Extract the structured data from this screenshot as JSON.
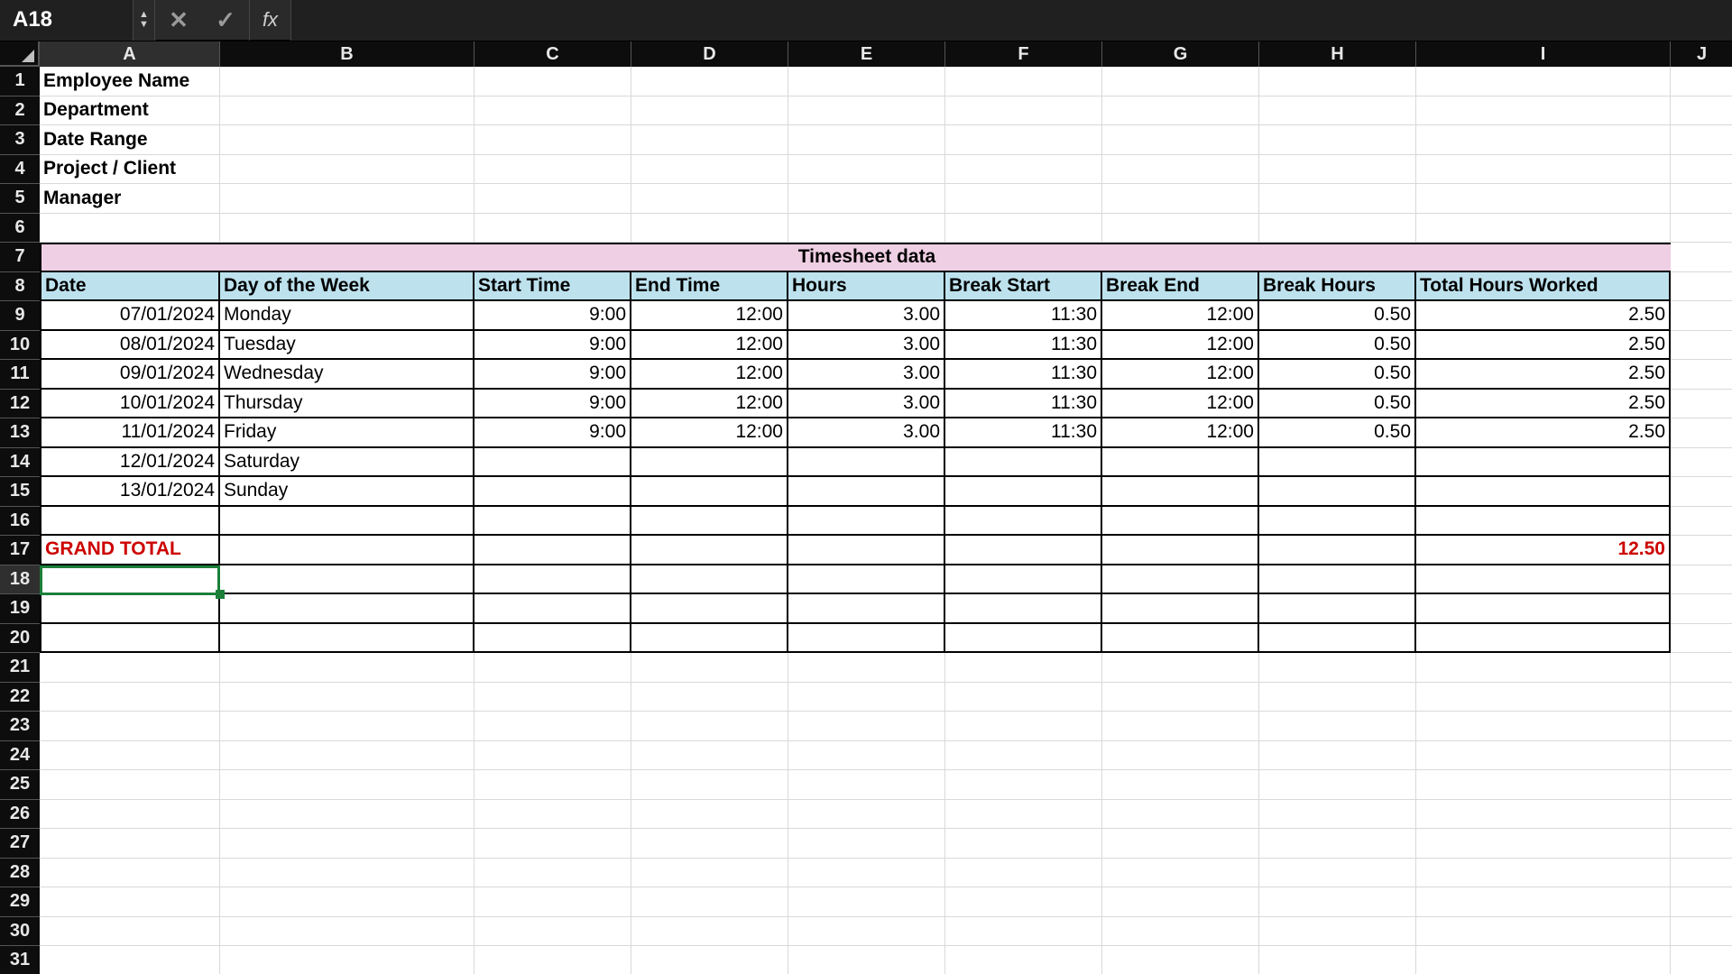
{
  "formula_bar": {
    "cell_ref": "A18",
    "fx_label": "fx",
    "cancel": "✕",
    "accept": "✓",
    "input_value": ""
  },
  "columns": [
    "A",
    "B",
    "C",
    "D",
    "E",
    "F",
    "G",
    "H",
    "I",
    "J"
  ],
  "row_numbers_start": 1,
  "visible_rows": 31,
  "active_cell": "A18",
  "meta_labels": {
    "r1": "Employee Name",
    "r2": "Department",
    "r3": "Date Range",
    "r4": "Project / Client",
    "r5": "Manager"
  },
  "section_title": "Timesheet data",
  "table_headers": {
    "A": "Date",
    "B": "Day of the Week",
    "C": "Start Time",
    "D": "End Time",
    "E": "Hours",
    "F": "Break Start",
    "G": "Break End",
    "H": "Break Hours",
    "I": "Total Hours Worked"
  },
  "data": [
    {
      "date": "07/01/2024",
      "dow": "Monday",
      "start": "9:00",
      "end": "12:00",
      "hours": "3.00",
      "bstart": "11:30",
      "bend": "12:00",
      "bhours": "0.50",
      "total": "2.50"
    },
    {
      "date": "08/01/2024",
      "dow": "Tuesday",
      "start": "9:00",
      "end": "12:00",
      "hours": "3.00",
      "bstart": "11:30",
      "bend": "12:00",
      "bhours": "0.50",
      "total": "2.50"
    },
    {
      "date": "09/01/2024",
      "dow": "Wednesday",
      "start": "9:00",
      "end": "12:00",
      "hours": "3.00",
      "bstart": "11:30",
      "bend": "12:00",
      "bhours": "0.50",
      "total": "2.50"
    },
    {
      "date": "10/01/2024",
      "dow": "Thursday",
      "start": "9:00",
      "end": "12:00",
      "hours": "3.00",
      "bstart": "11:30",
      "bend": "12:00",
      "bhours": "0.50",
      "total": "2.50"
    },
    {
      "date": "11/01/2024",
      "dow": "Friday",
      "start": "9:00",
      "end": "12:00",
      "hours": "3.00",
      "bstart": "11:30",
      "bend": "12:00",
      "bhours": "0.50",
      "total": "2.50"
    },
    {
      "date": "12/01/2024",
      "dow": "Saturday",
      "start": "",
      "end": "",
      "hours": "",
      "bstart": "",
      "bend": "",
      "bhours": "",
      "total": ""
    },
    {
      "date": "13/01/2024",
      "dow": "Sunday",
      "start": "",
      "end": "",
      "hours": "",
      "bstart": "",
      "bend": "",
      "bhours": "",
      "total": ""
    }
  ],
  "grand_total": {
    "label": "GRAND TOTAL",
    "value": "12.50"
  },
  "chart_data": {
    "type": "table",
    "title": "Timesheet data",
    "columns": [
      "Date",
      "Day of the Week",
      "Start Time",
      "End Time",
      "Hours",
      "Break Start",
      "Break End",
      "Break Hours",
      "Total Hours Worked"
    ],
    "rows": [
      [
        "07/01/2024",
        "Monday",
        "9:00",
        "12:00",
        3.0,
        "11:30",
        "12:00",
        0.5,
        2.5
      ],
      [
        "08/01/2024",
        "Tuesday",
        "9:00",
        "12:00",
        3.0,
        "11:30",
        "12:00",
        0.5,
        2.5
      ],
      [
        "09/01/2024",
        "Wednesday",
        "9:00",
        "12:00",
        3.0,
        "11:30",
        "12:00",
        0.5,
        2.5
      ],
      [
        "10/01/2024",
        "Thursday",
        "9:00",
        "12:00",
        3.0,
        "11:30",
        "12:00",
        0.5,
        2.5
      ],
      [
        "11/01/2024",
        "Friday",
        "9:00",
        "12:00",
        3.0,
        "11:30",
        "12:00",
        0.5,
        2.5
      ],
      [
        "12/01/2024",
        "Saturday",
        null,
        null,
        null,
        null,
        null,
        null,
        null
      ],
      [
        "13/01/2024",
        "Sunday",
        null,
        null,
        null,
        null,
        null,
        null,
        null
      ]
    ],
    "grand_total": 12.5
  }
}
